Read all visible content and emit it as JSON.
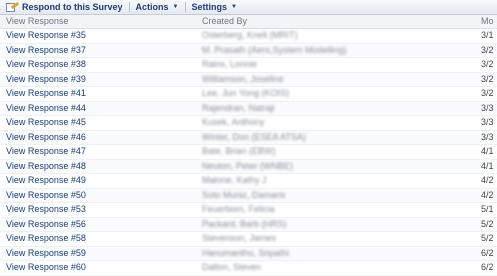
{
  "toolbar": {
    "respond_label": "Respond to this Survey",
    "actions_label": "Actions",
    "settings_label": "Settings"
  },
  "table": {
    "columns": [
      "View Response",
      "Created By",
      "Mo"
    ],
    "rows": [
      {
        "response": "View Response #35",
        "created_by": "Osterberg, Knell (MRIT)",
        "modified": "3/1"
      },
      {
        "response": "View Response #37",
        "created_by": "M. Prasath (Aero,System Modelling)",
        "modified": "3/2"
      },
      {
        "response": "View Response #38",
        "created_by": "Rains, Lonnie",
        "modified": "3/2"
      },
      {
        "response": "View Response #39",
        "created_by": "Williamson, Joseline",
        "modified": "3/2"
      },
      {
        "response": "View Response #41",
        "created_by": "Lee, Jun Yong (KOIS)",
        "modified": "3/2"
      },
      {
        "response": "View Response #44",
        "created_by": "Rajendran, Natraji",
        "modified": "3/3"
      },
      {
        "response": "View Response #45",
        "created_by": "Kusek, Anthony",
        "modified": "3/3"
      },
      {
        "response": "View Response #46",
        "created_by": "Winter, Don (ESEA ATSA)",
        "modified": "3/3"
      },
      {
        "response": "View Response #47",
        "created_by": "Bate, Brian (EBW)",
        "modified": "4/1"
      },
      {
        "response": "View Response #48",
        "created_by": "Neuton, Peter (WNBE)",
        "modified": "4/1"
      },
      {
        "response": "View Response #49",
        "created_by": "Malone, Kathy J",
        "modified": "4/2"
      },
      {
        "response": "View Response #50",
        "created_by": "Soto Muniz, Damaris",
        "modified": "4/2"
      },
      {
        "response": "View Response #53",
        "created_by": "Feuerborn, Felicia",
        "modified": "5/1"
      },
      {
        "response": "View Response #56",
        "created_by": "Packard, Barb (HRS)",
        "modified": "5/2"
      },
      {
        "response": "View Response #58",
        "created_by": "Stevenson, James",
        "modified": "5/2"
      },
      {
        "response": "View Response #59",
        "created_by": "Hanumanthu, Sripathi",
        "modified": "6/2"
      },
      {
        "response": "View Response #60",
        "created_by": "Dalton, Steven",
        "modified": "6/2"
      }
    ]
  }
}
